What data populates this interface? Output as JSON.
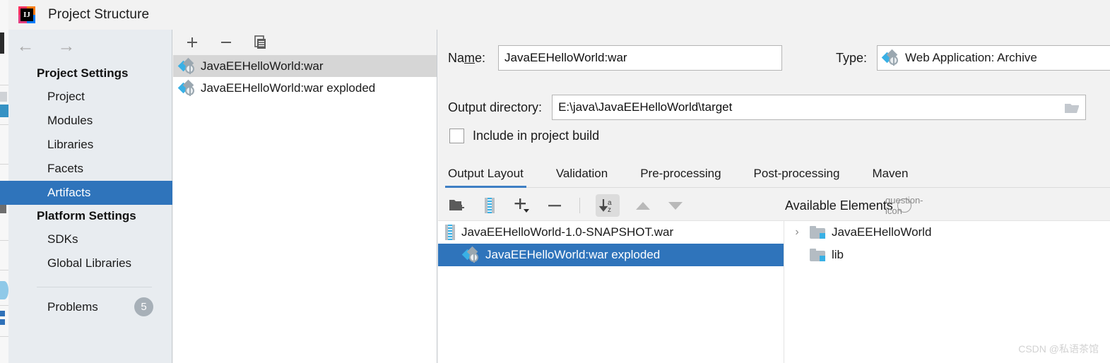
{
  "window": {
    "title": "Project Structure",
    "icon": "intellij-idea-icon"
  },
  "sidebar": {
    "back_icon": "←",
    "forward_icon": "→",
    "groups": [
      {
        "label": "Project Settings",
        "items": [
          {
            "label": "Project",
            "active": false
          },
          {
            "label": "Modules",
            "active": false
          },
          {
            "label": "Libraries",
            "active": false
          },
          {
            "label": "Facets",
            "active": false
          },
          {
            "label": "Artifacts",
            "active": true
          }
        ]
      },
      {
        "label": "Platform Settings",
        "items": [
          {
            "label": "SDKs",
            "active": false
          },
          {
            "label": "Global Libraries",
            "active": false
          }
        ]
      }
    ],
    "problems": {
      "label": "Problems",
      "count": "5"
    }
  },
  "artifact_list": {
    "toolbar": [
      {
        "name": "add-artifact-button",
        "icon": "plus-icon"
      },
      {
        "name": "remove-artifact-button",
        "icon": "minus-icon"
      },
      {
        "name": "copy-artifact-button",
        "icon": "copy-icon"
      }
    ],
    "items": [
      {
        "label": "JavaEEHelloWorld:war",
        "icon": "artifact-icon",
        "selected": true
      },
      {
        "label": "JavaEEHelloWorld:war exploded",
        "icon": "artifact-icon",
        "selected": false
      }
    ]
  },
  "detail": {
    "name_label": "Na",
    "name_label_mnemonic": "m",
    "name_label_tail": "e:",
    "name_value": "JavaEEHelloWorld:war",
    "type_label": "Type:",
    "type_value": "Web Application: Archive",
    "type_icon": "artifact-icon",
    "type_caret": "chevron-down-icon",
    "output_label": "Output directory:",
    "output_value": "E:\\java\\JavaEEHelloWorld\\target",
    "browse_icon": "folder-icon",
    "include_checkbox": {
      "label": "Include in project build",
      "checked": false
    },
    "tabs": [
      {
        "label": "Output Layout",
        "active": true
      },
      {
        "label": "Validation",
        "active": false
      },
      {
        "label": "Pre-processing",
        "active": false
      },
      {
        "label": "Post-processing",
        "active": false
      },
      {
        "label": "Maven",
        "active": false
      }
    ],
    "layout_toolbar": [
      {
        "name": "create-directory-button",
        "icon": "new-folder-icon"
      },
      {
        "name": "create-archive-button",
        "icon": "archive-icon"
      },
      {
        "name": "add-copy-button",
        "icon": "plus-dropdown-icon"
      },
      {
        "name": "remove-element-button",
        "icon": "minus-icon"
      },
      {
        "name": "sort-button",
        "icon": "sort-az-icon",
        "pressed": true
      },
      {
        "name": "move-up-button",
        "icon": "triangle-up-icon"
      },
      {
        "name": "move-down-button",
        "icon": "triangle-down-icon"
      }
    ],
    "output_tree": [
      {
        "label": "JavaEEHelloWorld-1.0-SNAPSHOT.war",
        "icon": "archive-icon",
        "indent": 0,
        "selected": false
      },
      {
        "label": "JavaEEHelloWorld:war exploded",
        "icon": "artifact-icon",
        "indent": 1,
        "selected": true
      }
    ],
    "available": {
      "title": "Available Elements",
      "help_icon": "question-icon",
      "items": [
        {
          "label": "JavaEEHelloWorld",
          "icon": "module-folder-icon",
          "expandable": true,
          "chevron": "›"
        },
        {
          "label": "lib",
          "icon": "module-folder-icon",
          "expandable": false,
          "chevron": ""
        }
      ]
    }
  },
  "watermark": "CSDN @私语茶馆"
}
